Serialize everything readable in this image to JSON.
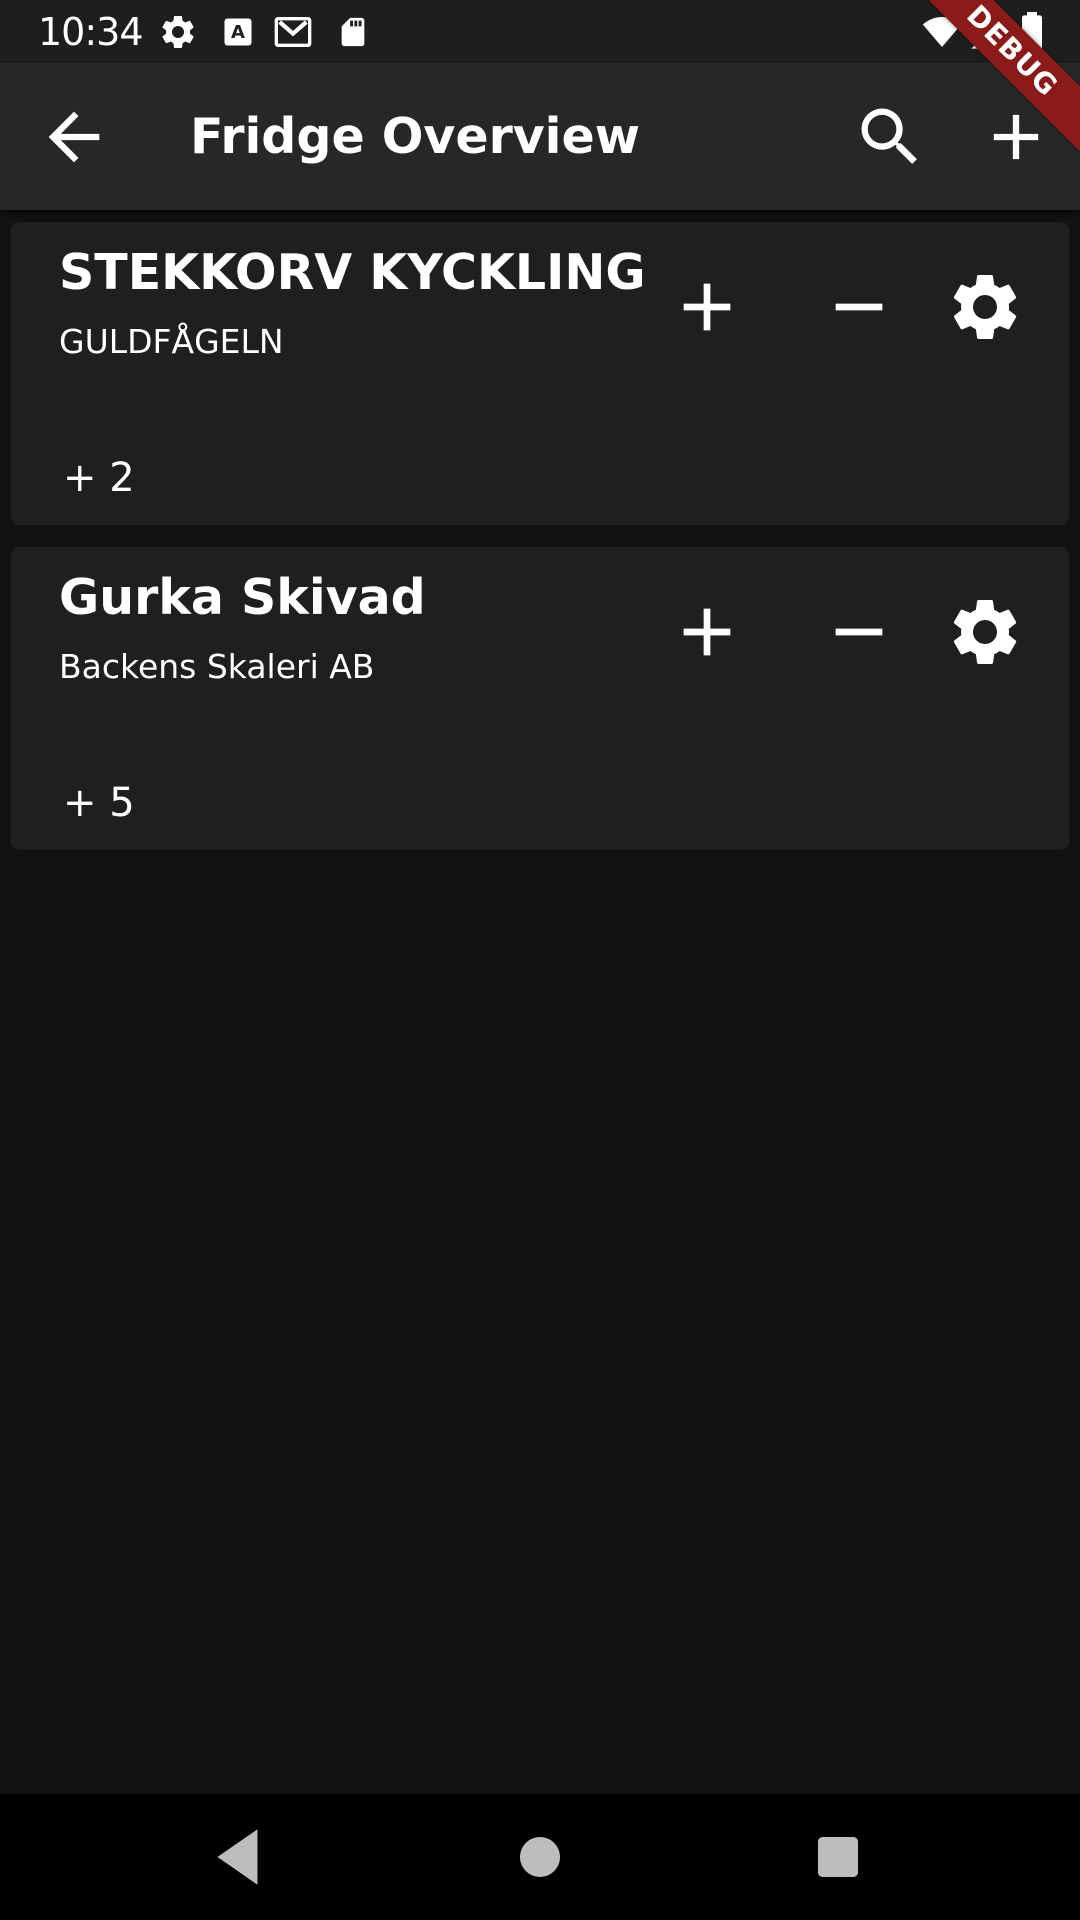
{
  "status_bar": {
    "time": "10:34",
    "icons": [
      "settings-icon",
      "text-a-icon",
      "gmail-icon",
      "sd-card-icon",
      "wifi-icon",
      "signal-icon",
      "battery-icon"
    ]
  },
  "app_bar": {
    "title": "Fridge Overview",
    "back_icon": "arrow-back-icon",
    "search_icon": "search-icon",
    "add_icon": "add-icon"
  },
  "debug_banner": "DEBUG",
  "items": [
    {
      "name": "STEKKORV KYCKLING",
      "brand": "GULDFÅGELN",
      "count": "+ 2"
    },
    {
      "name": "Gurka Skivad",
      "brand": "Backens Skaleri AB",
      "count": "+ 5"
    }
  ],
  "item_actions": {
    "increment_icon": "plus-icon",
    "decrement_icon": "minus-icon",
    "settings_icon": "gear-icon"
  },
  "nav_bar": {
    "back": "triangle-back-icon",
    "home": "circle-home-icon",
    "recents": "square-recents-icon"
  },
  "colors": {
    "background": "#121212",
    "app_bar": "#272727",
    "card": "#1f1f1f",
    "status_bar": "#1e1e1e",
    "debug_banner": "#8b1a1a",
    "text": "#ffffff"
  }
}
